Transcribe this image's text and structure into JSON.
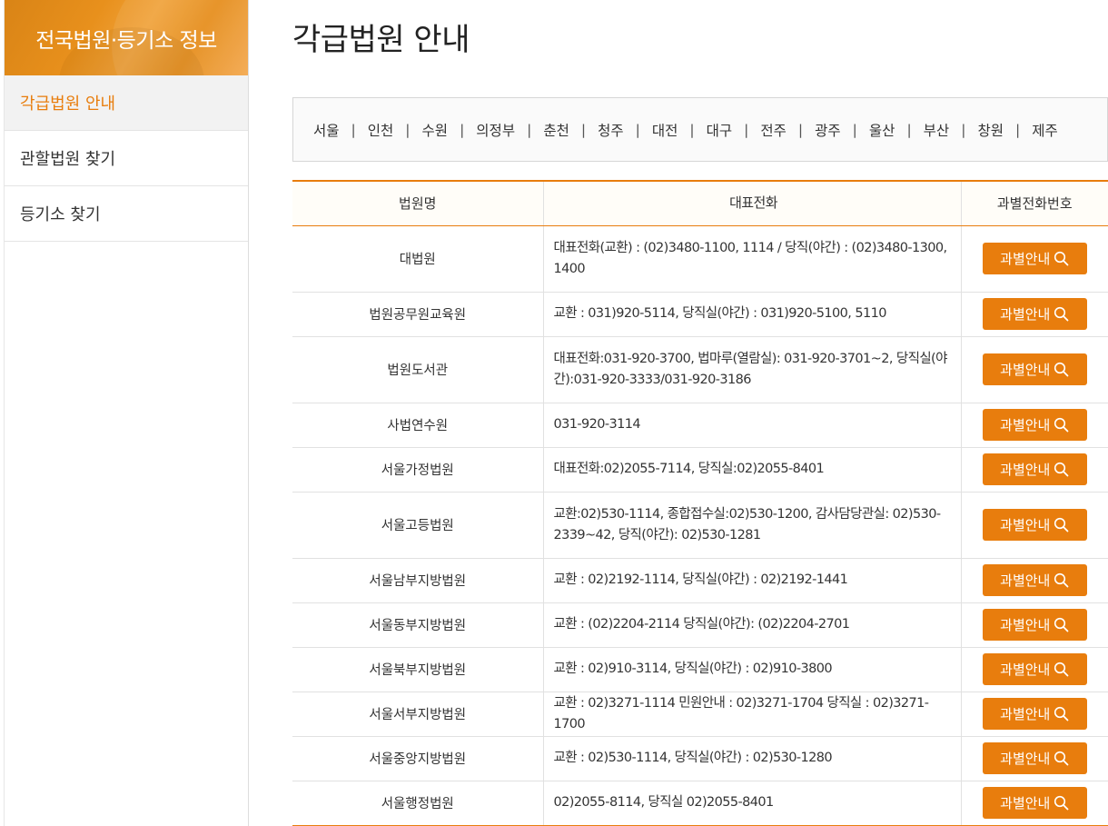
{
  "sidebar": {
    "title": "전국법원·등기소 정보",
    "items": [
      {
        "label": "각급법원 안내",
        "active": true
      },
      {
        "label": "관할법원 찾기",
        "active": false
      },
      {
        "label": "등기소 찾기",
        "active": false
      }
    ]
  },
  "main": {
    "title": "각급법원 안내",
    "regions": [
      "서울",
      "인천",
      "수원",
      "의정부",
      "춘천",
      "청주",
      "대전",
      "대구",
      "전주",
      "광주",
      "울산",
      "부산",
      "창원",
      "제주"
    ],
    "region_separator": "|",
    "table": {
      "headers": [
        "법원명",
        "대표전화",
        "과별전화번호"
      ],
      "button_label": "과별안내",
      "rows": [
        {
          "name": "대법원",
          "phone": "대표전화(교환) : (02)3480-1100, 1114 / 당직(야간) : (02)3480-1300, 1400",
          "tall": true
        },
        {
          "name": "법원공무원교육원",
          "phone": "교환 : 031)920-5114, 당직실(야간) : 031)920-5100, 5110",
          "tall": false
        },
        {
          "name": "법원도서관",
          "phone": "대표전화:031-920-3700, 법마루(열람실): 031-920-3701~2, 당직실(야간):031-920-3333/031-920-3186",
          "tall": true
        },
        {
          "name": "사법연수원",
          "phone": "031-920-3114",
          "tall": false
        },
        {
          "name": "서울가정법원",
          "phone": "대표전화:02)2055-7114, 당직실:02)2055-8401",
          "tall": false
        },
        {
          "name": "서울고등법원",
          "phone": "교환:02)530-1114, 종합접수실:02)530-1200, 감사담당관실: 02)530-2339~42, 당직(야간): 02)530-1281",
          "tall": true
        },
        {
          "name": "서울남부지방법원",
          "phone": "교환 : 02)2192-1114, 당직실(야간) : 02)2192-1441",
          "tall": false
        },
        {
          "name": "서울동부지방법원",
          "phone": "교환 : (02)2204-2114 당직실(야간): (02)2204-2701",
          "tall": false
        },
        {
          "name": "서울북부지방법원",
          "phone": "교환 : 02)910-3114, 당직실(야간) : 02)910-3800",
          "tall": false
        },
        {
          "name": "서울서부지방법원",
          "phone": "교환 : 02)3271-1114 민원안내 : 02)3271-1704 당직실 : 02)3271-1700",
          "tall": false
        },
        {
          "name": "서울중앙지방법원",
          "phone": "교환 : 02)530-1114, 당직실(야간) : 02)530-1280",
          "tall": false
        },
        {
          "name": "서울행정법원",
          "phone": "02)2055-8114, 당직실 02)2055-8401",
          "tall": false
        }
      ]
    }
  },
  "colors": {
    "accent": "#e87d0d",
    "active_bg": "#f2f2f2"
  }
}
